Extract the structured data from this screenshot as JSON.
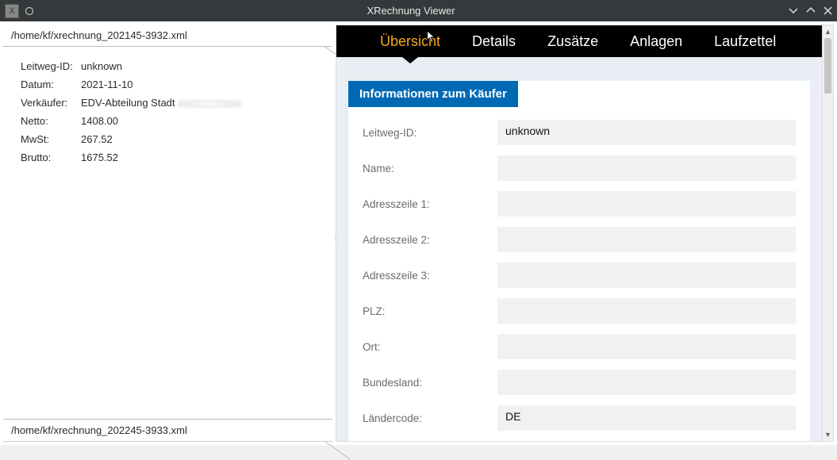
{
  "window": {
    "title": "XRechnung Viewer"
  },
  "files": {
    "file1": "/home/kf/xrechnung_202145-3932.xml",
    "file2": "/home/kf/xrechnung_202245-3933.xml"
  },
  "summary": {
    "leitweg_label": "Leitweg-ID:",
    "leitweg_value": "unknown",
    "datum_label": "Datum:",
    "datum_value": "2021-11-10",
    "verkaeufer_label": "Verkäufer:",
    "verkaeufer_value": "EDV-Abteilung Stadt",
    "netto_label": "Netto:",
    "netto_value": "1408.00",
    "mwst_label": "MwSt:",
    "mwst_value": "267.52",
    "brutto_label": "Brutto:",
    "brutto_value": "1675.52"
  },
  "tabs": {
    "uebersicht": "Übersicht",
    "details": "Details",
    "zusaetze": "Zusätze",
    "anlagen": "Anlagen",
    "laufzettel": "Laufzettel"
  },
  "section": {
    "header": "Informationen zum Käufer",
    "leitweg_label": "Leitweg-ID:",
    "leitweg_value": "unknown",
    "name_label": "Name:",
    "name_value": "",
    "addr1_label": "Adresszeile 1:",
    "addr1_value": "",
    "addr2_label": "Adresszeile 2:",
    "addr2_value": "",
    "addr3_label": "Adresszeile 3:",
    "addr3_value": "",
    "plz_label": "PLZ:",
    "plz_value": "",
    "ort_label": "Ort:",
    "ort_value": "",
    "bundesland_label": "Bundesland:",
    "bundesland_value": "",
    "laendercode_label": "Ländercode:",
    "laendercode_value": "DE"
  }
}
